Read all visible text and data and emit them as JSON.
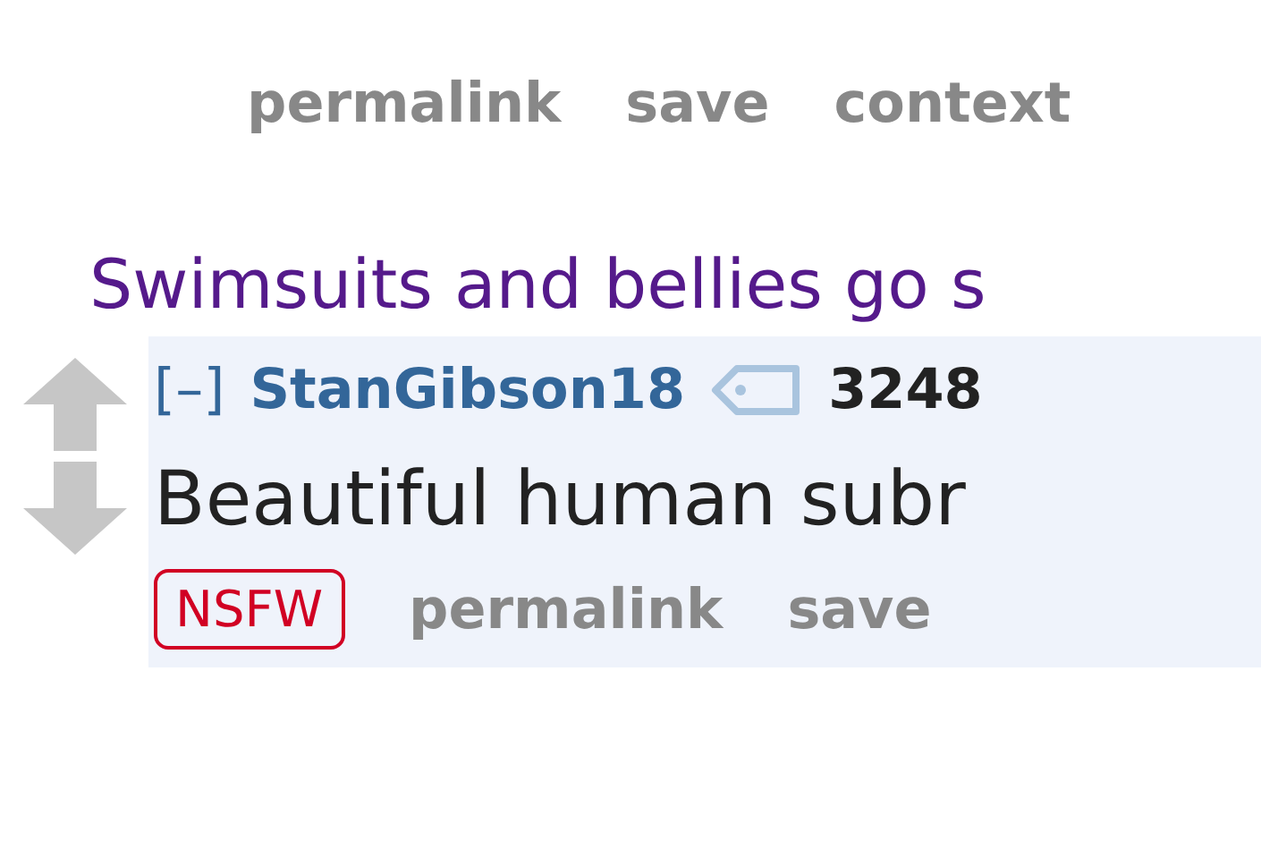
{
  "top_actions": [
    "permalink",
    "save",
    "context"
  ],
  "post_title": "Swimsuits and bellies go s",
  "comment": {
    "collapse": "[–]",
    "author": "StanGibson18",
    "score": "3248",
    "body": "Beautiful human subr",
    "badge": "NSFW",
    "actions": [
      "permalink",
      "save"
    ]
  }
}
